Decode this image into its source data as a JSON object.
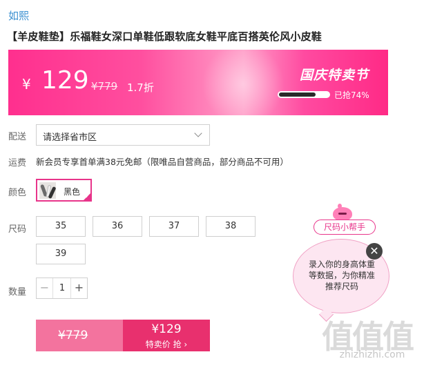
{
  "brand": "如熙",
  "product_title": "【羊皮鞋垫】乐福鞋女深口单鞋低跟软底女鞋平底百搭英伦风小皮鞋",
  "banner": {
    "currency_symbol": "¥",
    "price": "129",
    "original_price": "¥779",
    "discount": "1.7折",
    "festival_label": "国庆特卖节",
    "sold_text": "已抢74%",
    "sold_fraction": 0.74
  },
  "delivery": {
    "label": "配送",
    "placeholder": "请选择省市区"
  },
  "shipping": {
    "label": "运费",
    "text": "新会员专享首单满38元免邮（限唯品自营商品，部分商品不可用）"
  },
  "color": {
    "label": "颜色",
    "selected": "黑色"
  },
  "size": {
    "label": "尺码",
    "options": [
      "35",
      "36",
      "37",
      "38",
      "39"
    ]
  },
  "quantity": {
    "label": "数量",
    "minus": "−",
    "value": "1",
    "plus": "+"
  },
  "buy": {
    "original_price": "¥779",
    "price": "¥129",
    "cta": "特卖价 抢 ›"
  },
  "size_helper": {
    "title": "尺码小帮手",
    "message": "录入你的身高体重等数据，为你精准推荐尺码",
    "close": "✕"
  },
  "watermark": {
    "glyphs": "值值值",
    "site": "zhizhizhi.com"
  },
  "colors": {
    "accent": "#e8348a",
    "link": "#3a8fd0",
    "buy_left": "#f3739e",
    "buy_right": "#e8306e"
  }
}
